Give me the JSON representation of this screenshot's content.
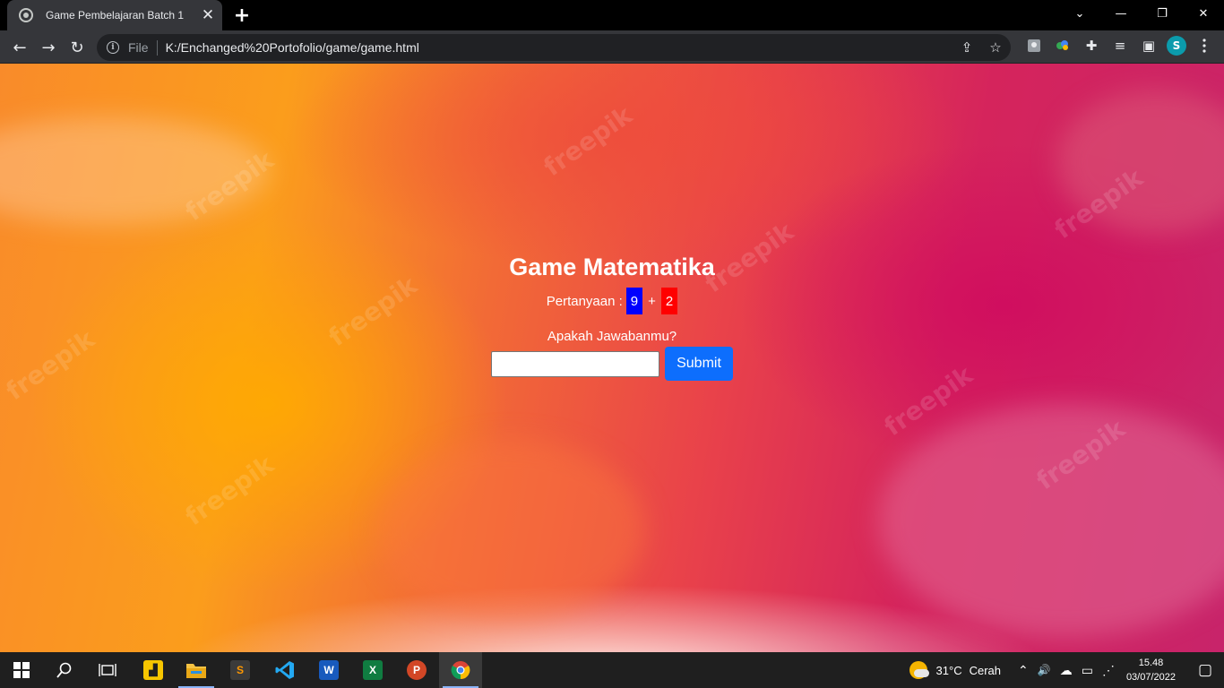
{
  "browser": {
    "tab_title": "Game Pembelajaran Batch 1",
    "tab_close": "✕",
    "new_tab": "+",
    "scheme_label": "File",
    "url": "K:/Enchanged%20Portofolio/game/game.html",
    "profile_initial": "S",
    "window_buttons": {
      "chevron": "⌄",
      "minimize": "—",
      "restore": "❐",
      "close": "✕"
    },
    "nav": {
      "back": "←",
      "forward": "→",
      "reload": "↻"
    },
    "info_glyph": "i",
    "omni_icons": {
      "share": "⇪",
      "bookmark": "☆"
    },
    "ext_icons": {
      "puzzle": "✚",
      "media": "≡",
      "sidepanel": "▣"
    }
  },
  "page": {
    "title": "Game Matematika",
    "question_label": "Pertanyaan :",
    "operand_a": "9",
    "operator": "+",
    "operand_b": "2",
    "answer_prompt": "Apakah Jawabanmu?",
    "answer_value": "",
    "submit_label": "Submit",
    "watermark": "freepik",
    "colors": {
      "operand_a_bg": "#0000ff",
      "operand_b_bg": "#ff0000",
      "submit_bg": "#0d6efd"
    }
  },
  "taskbar": {
    "apps": [
      "start",
      "search",
      "task-view",
      "sticky-notes",
      "file-explorer",
      "sublime-text",
      "vs-code",
      "word",
      "excel",
      "powerpoint",
      "chrome"
    ],
    "app_letters": {
      "sublime": "S",
      "word": "W",
      "excel": "X",
      "powerpoint": "P"
    },
    "weather_temp": "31°C",
    "weather_text": "Cerah",
    "tray_glyphs": {
      "chevron": "⌃",
      "volume": "🔊",
      "cloud": "☁",
      "battery": "▭",
      "wifi": "⋰",
      "notification": "▢"
    },
    "time": "15.48",
    "date": "03/07/2022"
  }
}
